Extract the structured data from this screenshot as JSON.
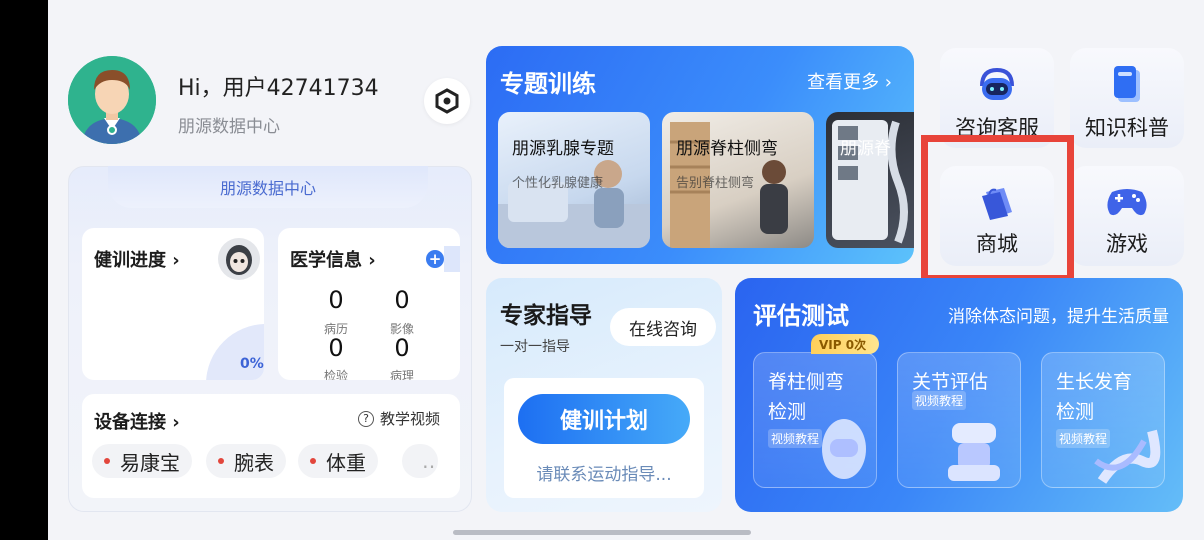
{
  "profile": {
    "greeting": "Hi，用户42741734",
    "org": "朋源数据中心"
  },
  "data_center": {
    "tab_label": "朋源数据中心",
    "training": {
      "title": "健训进度 ›",
      "progress": "0%"
    },
    "medical": {
      "title": "医学信息 ›",
      "stats": [
        {
          "value": "0",
          "label": "病历"
        },
        {
          "value": "0",
          "label": "影像"
        },
        {
          "value": "0",
          "label": "检验"
        },
        {
          "value": "0",
          "label": "病理"
        }
      ]
    },
    "devices": {
      "title": "设备连接 ›",
      "tutorial": "教学视频",
      "items": [
        "易康宝",
        "腕表",
        "体重",
        "…"
      ]
    }
  },
  "topic": {
    "title": "专题训练",
    "more": "查看更多 ›",
    "cards": [
      {
        "title": "朋源乳腺专题",
        "desc": "个性化乳腺健康"
      },
      {
        "title": "朋源脊柱侧弯",
        "desc": "告别脊柱侧弯"
      },
      {
        "title": "朋源脊",
        "desc": ""
      }
    ]
  },
  "tiles": [
    {
      "label": "咨询客服",
      "icon": "headset-robot-icon"
    },
    {
      "label": "知识科普",
      "icon": "book-icon"
    },
    {
      "label": "商城",
      "icon": "shopping-bag-icon"
    },
    {
      "label": "游戏",
      "icon": "gamepad-icon"
    }
  ],
  "expert": {
    "title": "专家指导",
    "subtitle": "一对一指导",
    "online_btn": "在线咨询",
    "plan_btn": "健训计划",
    "plan_hint": "请联系运动指导..."
  },
  "assess": {
    "title": "评估测试",
    "slogan": "消除体态问题，提升生活质量",
    "vip": "VIP 0次",
    "cards": [
      {
        "line1": "脊柱侧弯",
        "line2": "检测",
        "badge": "视频教程"
      },
      {
        "line1": "关节评估",
        "line2": "",
        "badge": "视频教程"
      },
      {
        "line1": "生长发育",
        "line2": "检测",
        "badge": "视频教程"
      }
    ]
  },
  "colors": {
    "accent": "#2c6cf4",
    "highlight": "#e8443a"
  }
}
